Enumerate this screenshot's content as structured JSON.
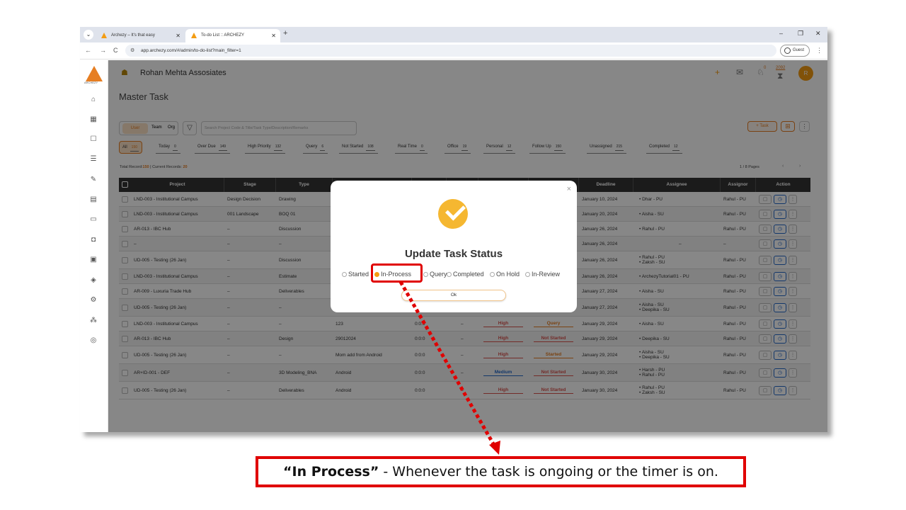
{
  "browser": {
    "tabs": [
      {
        "title": "Archezy – It's that easy",
        "active": false
      },
      {
        "title": "To-do List :: ARCHEZY",
        "active": true
      }
    ],
    "new_tab": "+",
    "url": "app.archezy.com/#/admin/to-do-list?main_filter=1",
    "profile": "Guest",
    "win_minimize": "–",
    "win_restore": "❐",
    "win_close": "✕"
  },
  "app": {
    "logo_text": "ARCHEZY",
    "company": "Rohan Mehta Assosiates",
    "notif_count": "0",
    "badge_count": "2092",
    "avatar_initial": "R",
    "page_title": "Master Task",
    "scope": {
      "user": "User",
      "team": "Team",
      "org": "Org"
    },
    "search_placeholder": "Search Project Code & Title/Task Type/Description/Remarks",
    "task_button": "+ Task",
    "filters": [
      {
        "label": "All",
        "count": "150"
      },
      {
        "label": "Today",
        "count": "0"
      },
      {
        "label": "Over Due",
        "count": "149"
      },
      {
        "label": "High Priority",
        "count": "132"
      },
      {
        "label": "Query",
        "count": "6"
      },
      {
        "label": "Not Started",
        "count": "108"
      },
      {
        "label": "Real Time",
        "count": "0"
      },
      {
        "label": "Office",
        "count": "19"
      },
      {
        "label": "Personal",
        "count": "12"
      },
      {
        "label": "Follow Up",
        "count": "150"
      },
      {
        "label": "Unassigned",
        "count": "215"
      },
      {
        "label": "Completed",
        "count": "12"
      }
    ],
    "records": {
      "prefix": "Total Record:",
      "total": "150",
      "mid": " | Current Records: ",
      "current": "20"
    },
    "pages": "1 / 8 Pages",
    "table": {
      "headers": [
        "Project",
        "Stage",
        "Type",
        "Deadline",
        "Assignee",
        "Assignor",
        "Action"
      ],
      "rows": [
        {
          "project": "LND-003 - Institutional Campus",
          "stage": "Design Decision",
          "type": "Drawing",
          "desc": "",
          "time": "",
          "dash": "",
          "priority": "",
          "status": "",
          "deadline": "January 10, 2024",
          "assignee": [
            "Dhar - PU"
          ],
          "assignor": "Rahul - PU"
        },
        {
          "project": "LND-003 - Institutional Campus",
          "stage": "001 Landscape",
          "type": "BOQ 01",
          "desc": "",
          "time": "",
          "dash": "",
          "priority": "",
          "status": "",
          "deadline": "January 20, 2024",
          "assignee": [
            "Aisha - SU"
          ],
          "assignor": "Rahul - PU"
        },
        {
          "project": "AR-013 - IBC Hub",
          "stage": "–",
          "type": "Discussion",
          "desc": "",
          "time": "",
          "dash": "",
          "priority": "",
          "status": "",
          "deadline": "January 26, 2024",
          "assignee": [
            "Rahul - PU"
          ],
          "assignor": "Rahul - PU"
        },
        {
          "project": "–",
          "stage": "–",
          "type": "–",
          "desc": "",
          "time": "",
          "dash": "",
          "priority": "",
          "status": "",
          "deadline": "January 26, 2024",
          "assignee": [
            "–"
          ],
          "assignor": "–"
        },
        {
          "project": "UD-005 - Testing (26 Jan)",
          "stage": "–",
          "type": "Discussion",
          "desc": "",
          "time": "",
          "dash": "",
          "priority": "",
          "status": "",
          "deadline": "January 26, 2024",
          "assignee": [
            "Rahul - PU",
            "Zaksh - SU"
          ],
          "assignor": "Rahul - PU"
        },
        {
          "project": "LND-003 - Institutional Campus",
          "stage": "–",
          "type": "Estimate",
          "desc": "",
          "time": "",
          "dash": "",
          "priority": "",
          "status": "",
          "deadline": "January 26, 2024",
          "assignee": [
            "ArchezyTutorial01 - PU"
          ],
          "assignor": "Rahul - PU"
        },
        {
          "project": "AR-009 - Luxuria Trade Hub",
          "stage": "–",
          "type": "Deliverables",
          "desc": "",
          "time": "",
          "dash": "",
          "priority": "",
          "status": "",
          "deadline": "January 27, 2024",
          "assignee": [
            "Aisha - SU"
          ],
          "assignor": "Rahul - PU"
        },
        {
          "project": "UD-005 - Testing (26 Jan)",
          "stage": "–",
          "type": "–",
          "desc": "",
          "time": "",
          "dash": "",
          "priority": "",
          "status": "",
          "deadline": "January 27, 2024",
          "assignee": [
            "Aisha - SU",
            "Deepika - SU"
          ],
          "assignor": "Rahul - PU"
        },
        {
          "project": "LND-003 - Institutional Campus",
          "stage": "–",
          "type": "–",
          "desc": "123",
          "time": "0:0:0",
          "dash": "–",
          "priority": "High",
          "status": "Query",
          "deadline": "January 29, 2024",
          "assignee": [
            "Aisha - SU"
          ],
          "assignor": "Rahul - PU"
        },
        {
          "project": "AR-013 - IBC Hub",
          "stage": "–",
          "type": "Design",
          "desc": "29012024",
          "time": "0:0:0",
          "dash": "–",
          "priority": "High",
          "status": "Not Started",
          "deadline": "January 29, 2024",
          "assignee": [
            "Deepika - SU"
          ],
          "assignor": "Rahul - PU"
        },
        {
          "project": "UD-005 - Testing (26 Jan)",
          "stage": "–",
          "type": "–",
          "desc": "Mom add from Android",
          "time": "0:0:0",
          "dash": "–",
          "priority": "High",
          "status": "Started",
          "deadline": "January 29, 2024",
          "assignee": [
            "Aisha - SU",
            "Deepika - SU"
          ],
          "assignor": "Rahul - PU"
        },
        {
          "project": "AR+ID-001 - DEF",
          "stage": "–",
          "type": "3D Modeling_BNA",
          "desc": "Android",
          "time": "0:0:0",
          "dash": "–",
          "priority": "Medium",
          "status": "Not Started",
          "deadline": "January 30, 2024",
          "assignee": [
            "Harsh - PU",
            "Rahul - PU"
          ],
          "assignor": "Rahul - PU"
        },
        {
          "project": "UD-005 - Testing (26 Jan)",
          "stage": "–",
          "type": "Deliverables",
          "desc": "Android",
          "time": "0:0:0",
          "dash": "–",
          "priority": "High",
          "status": "Not Started",
          "deadline": "January 30, 2024",
          "assignee": [
            "Rahul - PU",
            "Zaksh - SU"
          ],
          "assignor": "Rahul - PU"
        }
      ]
    }
  },
  "modal": {
    "title": "Update Task Status",
    "options": [
      {
        "label": "Started",
        "selected": false
      },
      {
        "label": "In-Process",
        "selected": true
      },
      {
        "label": "Query",
        "selected": false
      },
      {
        "label": "Completed",
        "selected": false
      },
      {
        "label": "On Hold",
        "selected": false
      },
      {
        "label": "In-Review",
        "selected": false
      }
    ],
    "ok": "Ok",
    "close": "×"
  },
  "caption": {
    "term": "“In Process”",
    "text": " - Whenever the task is ongoing or the timer is on."
  },
  "colors": {
    "accent": "#f39c12",
    "highlight": "#e00000",
    "high": "#d9534f",
    "medium": "#2468c8"
  }
}
